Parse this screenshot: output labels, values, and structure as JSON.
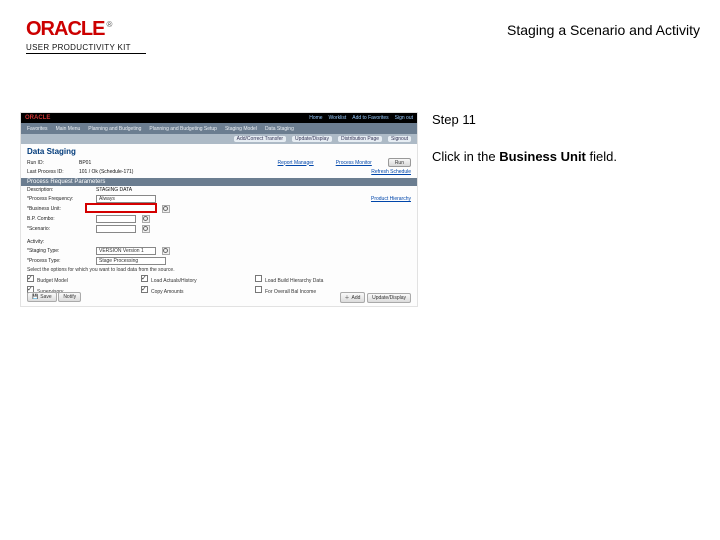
{
  "header": {
    "brand": "ORACLE",
    "tm": "®",
    "product_line": "USER PRODUCTIVITY KIT",
    "doc_title": "Staging a Scenario and Activity"
  },
  "instruction": {
    "step_label": "Step 11",
    "prefix": "Click in the ",
    "bold": "Business Unit",
    "suffix": " field."
  },
  "screenshot": {
    "top_brand": "ORACLE",
    "top_links": [
      "Home",
      "Worklist",
      "Add to Favorites",
      "Sign out"
    ],
    "nav": [
      "Favorites",
      "Main Menu",
      "Planning and Budgeting",
      "Planning and Budgeting Setup",
      "Staging Model",
      "Data Staging"
    ],
    "crumb": [
      "Add/Correct Transfer",
      "Update/Display",
      "Distribution Page",
      "Signout"
    ],
    "page_title": "Data Staging",
    "run_row": {
      "label": "Run ID:",
      "value": "BP01",
      "link1": "Report Manager",
      "link2": "Process Monitor",
      "btn": "Run"
    },
    "sched_row": {
      "label": "Last Process ID:",
      "value": "101 / Ok (Schedule-171)",
      "link": "Refresh Schedule"
    },
    "section": "Process Request Parameters",
    "params": {
      "description": {
        "label": "Description:",
        "value": "STAGING DATA"
      },
      "process_frequency": {
        "label": "*Process Frequency:",
        "value": "Always"
      },
      "business_unit": {
        "label": "*Business Unit:"
      },
      "bp_combo": {
        "label": "B.P. Combo:"
      },
      "scenario": {
        "label": "*Scenario:"
      },
      "activity": {
        "label": "Activity:"
      },
      "staging_type": {
        "label": "*Staging Type:",
        "value": "VERSION Version 1"
      },
      "process_type": {
        "label": "*Process Type:",
        "value": "Stage Processing"
      },
      "subhead": "Select the options for which you want to load data from the source.",
      "product_hierarchy_link": "Product Hierarchy",
      "checks": [
        {
          "label": "Budget Model",
          "checked": true
        },
        {
          "label": "Supervisory",
          "checked": true
        },
        {
          "label": "Load Actuals/History",
          "checked": true
        },
        {
          "label": "Load Build Hierarchy Data",
          "checked": false
        },
        {
          "label": "Copy Amounts",
          "checked": true
        },
        {
          "label": "For Overall Bal Income",
          "checked": false
        }
      ]
    },
    "footer": {
      "left": [
        "Save",
        "Notify"
      ],
      "right": [
        "Add",
        "Update/Display"
      ]
    }
  }
}
